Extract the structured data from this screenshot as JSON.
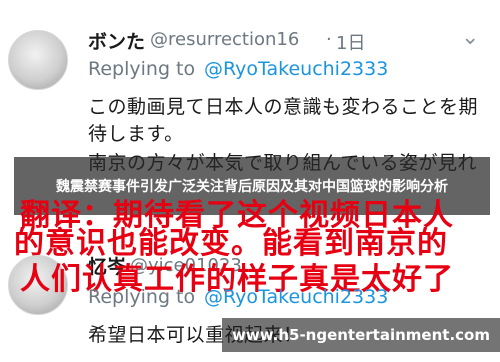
{
  "tweet1": {
    "display_name": "ボンた",
    "handle": "@resurrection16",
    "dot": "·",
    "time": "1日",
    "reply_prefix": "Replying to",
    "reply_to": "@RyoTakeuchi2333",
    "lines": [
      "この動画見て日本人の意識も変わることを期",
      "待します。",
      "南京の方々が本気で取り組んでいる姿が見れ"
    ],
    "more_icon": "chevron-down-icon"
  },
  "overlay_title": "魏震禁赛事件引发广泛关注背后原因及其对中国篮球的影响分析",
  "translation": {
    "lines": [
      "翻译：期待看了这个视频日本人",
      "的意识也能改变。能看到南京的",
      "人们认真工作的样子真是太好了"
    ],
    "color": "#e60012"
  },
  "tweet2": {
    "display_name": "忆岑",
    "handle": "@yice01023",
    "reply_prefix": "Replying to",
    "reply_to": "@RyoTakeuchi2333",
    "lines": [
      "希望日本可以重视起来！"
    ]
  },
  "watermark": "www.h5-ngentertainment.com",
  "colors": {
    "link": "#1b95e0",
    "muted": "#6d7882",
    "text": "#1a1a1a"
  }
}
